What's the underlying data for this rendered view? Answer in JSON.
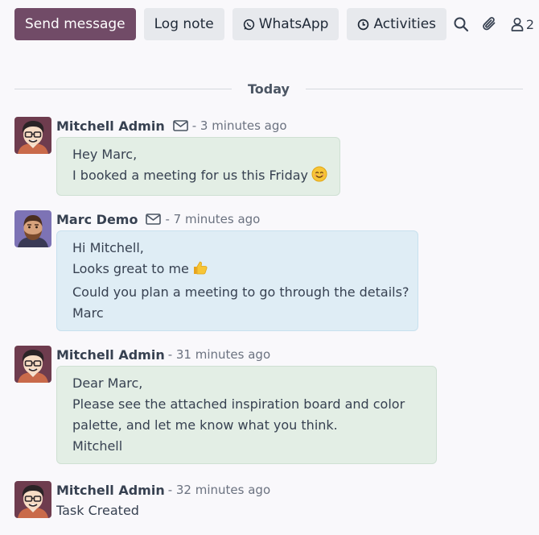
{
  "toolbar": {
    "send_message": "Send message",
    "log_note": "Log note",
    "whatsapp": "WhatsApp",
    "activities": "Activities",
    "followers_count": "2"
  },
  "separator": {
    "label": "Today"
  },
  "messages": [
    {
      "author": "Mitchell Admin",
      "time": "- 3 minutes ago",
      "lines": [
        "Hey Marc,",
        "I booked a meeting for us this Friday"
      ]
    },
    {
      "author": "Marc Demo",
      "time": "- 7 minutes ago",
      "lines": [
        "Hi Mitchell,",
        "Looks great to me",
        "Could you plan a meeting to go through the details?",
        "Marc"
      ]
    },
    {
      "author": "Mitchell Admin",
      "time": "- 31 minutes ago",
      "lines": [
        "Dear Marc,",
        "Please see the attached inspiration board and color",
        "palette, and let me know what you think.",
        "Mitchell"
      ]
    },
    {
      "author": "Mitchell Admin",
      "time": "- 32 minutes ago",
      "lines": [
        "Task Created"
      ]
    }
  ],
  "colors": {
    "primary": "#714b67",
    "secondary_button": "#e7e9ed",
    "green_bubble": "#e3eee5",
    "blue_bubble": "#dfedf5"
  }
}
